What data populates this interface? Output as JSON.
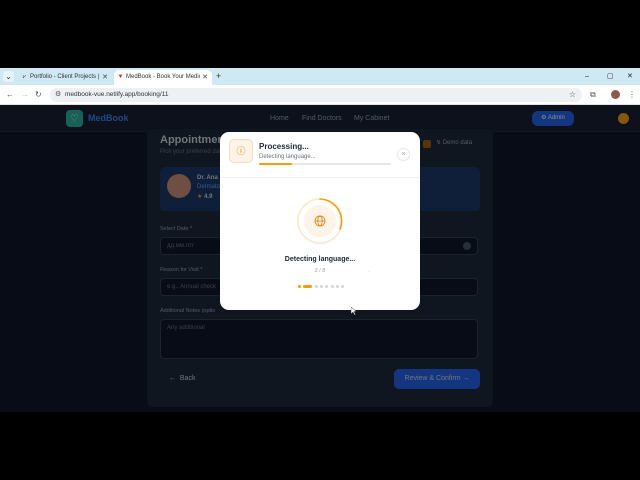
{
  "browser": {
    "tabs": [
      {
        "title": "Portfolio - Client Projects | Wo",
        "active": false
      },
      {
        "title": "MedBook - Book Your Medical",
        "active": true
      }
    ],
    "new_tab": "+",
    "window": {
      "minimize": "–",
      "maximize": "▢",
      "close": "✕"
    },
    "url": "medbook-vue.netlify.app/booking/11"
  },
  "site": {
    "logo": "MedBook",
    "nav": [
      "Home",
      "Find Doctors",
      "My Cabinet"
    ],
    "admin_label": "Admin"
  },
  "card": {
    "title": "Appointment Details",
    "subtitle": "Pick your preferred date and time",
    "demo_label": "Demo data",
    "doctor": {
      "name": "Dr. Ana",
      "specialty": "Dermato",
      "rating": "4.9"
    },
    "date_label": "Select Date *",
    "date_placeholder": "дд.мм.гггг",
    "reason_label": "Reason for Visit *",
    "reason_placeholder": "e.g., Annual check",
    "notes_label": "Additional Notes (optio",
    "notes_placeholder": "Any additional",
    "back_label": "Back",
    "review_label": "Review & Confirm"
  },
  "modal": {
    "title": "Processing...",
    "subtitle": "Detecting language...",
    "progress": 0.25,
    "close": "×",
    "step_text": "Detecting language...",
    "step_count": "2 / 8",
    "steps_total": 8,
    "steps_current": 2,
    "faint_text": "·",
    "accent": "#f59e0b"
  }
}
